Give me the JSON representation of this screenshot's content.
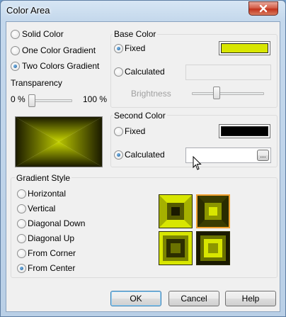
{
  "window": {
    "title": "Color Area"
  },
  "gradient_type": {
    "options": [
      "Solid Color",
      "One Color Gradient",
      "Two Colors Gradient"
    ],
    "selected": "Two Colors Gradient"
  },
  "transparency": {
    "label": "Transparency",
    "min_label": "0 %",
    "max_label": "100 %",
    "value_percent": 0
  },
  "base_color": {
    "title": "Base Color",
    "fixed_label": "Fixed",
    "calculated_label": "Calculated",
    "brightness_label": "Brightness",
    "selected": "Fixed",
    "color": "#d8e600",
    "brightness_level": 0.33
  },
  "second_color": {
    "title": "Second Color",
    "fixed_label": "Fixed",
    "calculated_label": "Calculated",
    "selected": "Calculated",
    "color": "#000000",
    "browse_label": "..."
  },
  "gradient_style": {
    "title": "Gradient Style",
    "options": [
      "Horizontal",
      "Vertical",
      "Diagonal Down",
      "Diagonal Up",
      "From Corner",
      "From Center"
    ],
    "selected": "From Center",
    "selected_variant": 2
  },
  "buttons": {
    "ok": "OK",
    "cancel": "Cancel",
    "help": "Help"
  },
  "colors": {
    "accent": "#d8e600",
    "dark": "#1a1a00",
    "highlight": "#f0a030"
  }
}
